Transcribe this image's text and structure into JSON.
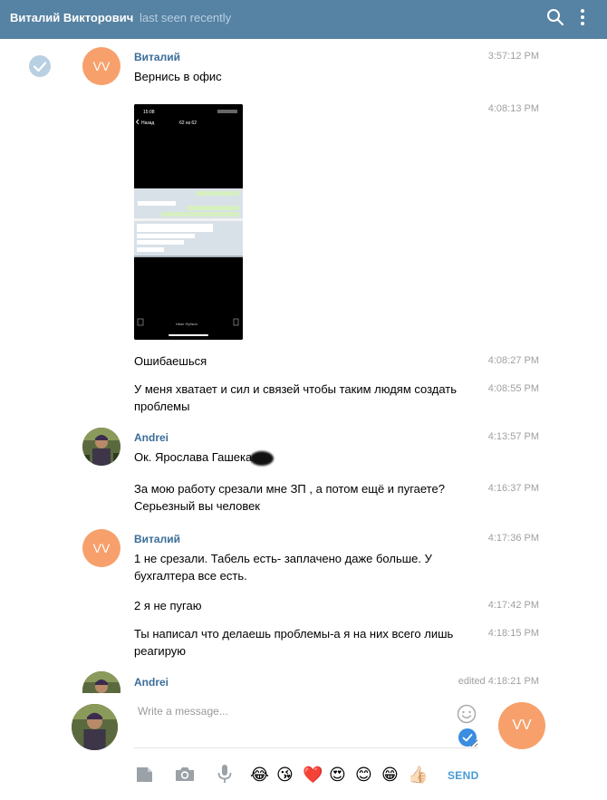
{
  "header": {
    "contact_name": "Виталий Викторович",
    "status": "last seen recently"
  },
  "messages": [
    {
      "author": "Виталий",
      "initials": "VV",
      "text": "Вернись в офис",
      "time": "3:57:12 PM"
    },
    {
      "time": "4:08:13 PM"
    },
    {
      "text": "Ошибаешься",
      "time": "4:08:27 PM"
    },
    {
      "text": "У меня хватает и сил и связей чтобы таким людям создать проблемы",
      "time": "4:08:55 PM"
    },
    {
      "author": "Andrei",
      "text": "Ок. Ярослава Гашека",
      "time": "4:13:57 PM"
    },
    {
      "text": "За мою работу срезали мне ЗП , а потом ещё и пугаете? Серьезный вы человек",
      "time": "4:16:37 PM"
    },
    {
      "author": "Виталий",
      "initials": "VV",
      "text": "1 не срезали. Табель есть- заплачено даже больше. У бухгалтера все есть.",
      "time": "4:17:36 PM"
    },
    {
      "text": "2 я не пугаю",
      "time": "4:17:42 PM"
    },
    {
      "text": "Ты написал что делаешь проблемы-а я на них всего лишь реагирую",
      "time": "4:18:15 PM"
    },
    {
      "author": "Andrei",
      "time": "edited 4:18:21 PM"
    }
  ],
  "attachment": {
    "top_time": "15:08",
    "back_label": "Назад",
    "counter": "62 из 62"
  },
  "composer": {
    "placeholder": "Write a message...",
    "avatar_initials": "VV",
    "send_label": "SEND",
    "emojis": [
      "😂",
      "😘",
      "❤️",
      "😍",
      "😊",
      "😁",
      "👍🏻"
    ]
  }
}
